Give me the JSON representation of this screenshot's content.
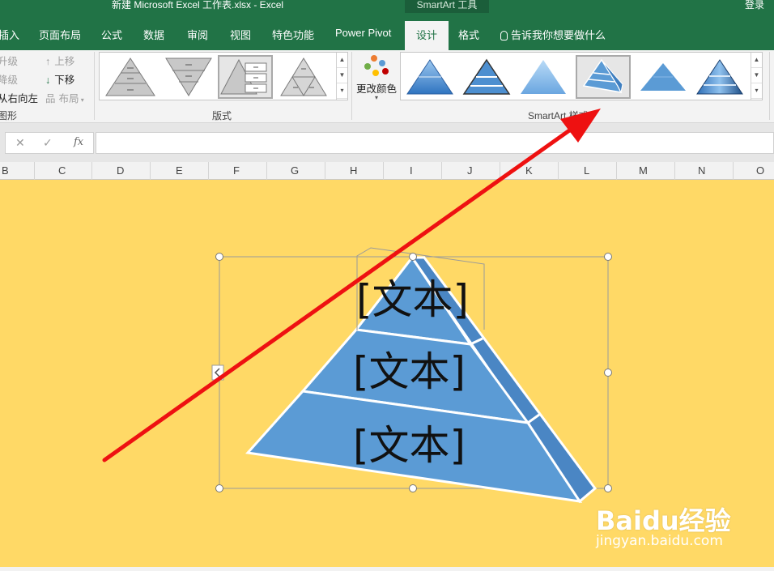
{
  "window": {
    "title": "新建 Microsoft Excel 工作表.xlsx  -  Excel",
    "context_tab_group": "SmartArt 工具",
    "login": "登录"
  },
  "tabs": [
    "插入",
    "页面布局",
    "公式",
    "数据",
    "审阅",
    "视图",
    "特色功能",
    "Power Pivot",
    "设计",
    "格式"
  ],
  "active_tab": "设计",
  "tell_me": "告诉我你想要做什么",
  "ribbon": {
    "create_graphic": {
      "promote": "升级",
      "demote": "降级",
      "right_to_left": "从右向左",
      "move_up": "上移",
      "move_down": "下移",
      "layout": "布局",
      "group_label": "图形"
    },
    "layouts_group_label": "版式",
    "change_colors": "更改颜色",
    "styles_group_label": "SmartArt 样式"
  },
  "formula_bar": {
    "cancel": "✕",
    "enter": "✓",
    "fx": "fx",
    "value": ""
  },
  "columns": [
    "B",
    "C",
    "D",
    "E",
    "F",
    "G",
    "H",
    "I",
    "J",
    "K",
    "L",
    "M",
    "N",
    "O"
  ],
  "smartart": {
    "placeholders": [
      "[文本]",
      "[文本]",
      "[文本]"
    ],
    "fill_color": "#5b9bd5",
    "side_color": "#4a86c4"
  },
  "colors": {
    "excel_green": "#217346",
    "sheet_fill": "#ffd966",
    "annotation_arrow": "#ee1111"
  },
  "watermark": {
    "brand": "Baidu经验",
    "site": "jingyan.baidu.com"
  }
}
